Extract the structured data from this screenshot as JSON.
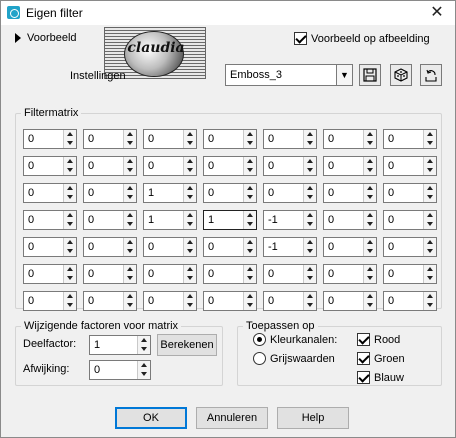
{
  "window": {
    "title": "Eigen filter"
  },
  "preview": {
    "label": "Voorbeeld",
    "on_image_label": "Voorbeeld op afbeelding",
    "on_image_checked": true
  },
  "logo": {
    "text": "claudia"
  },
  "settings": {
    "label": "Instellingen",
    "preset": "Emboss_3"
  },
  "filtermatrix": {
    "label": "Filtermatrix",
    "rows": [
      [
        "0",
        "0",
        "0",
        "0",
        "0",
        "0",
        "0"
      ],
      [
        "0",
        "0",
        "0",
        "0",
        "0",
        "0",
        "0"
      ],
      [
        "0",
        "0",
        "1",
        "0",
        "0",
        "0",
        "0"
      ],
      [
        "0",
        "0",
        "1",
        "1",
        "-1",
        "0",
        "0"
      ],
      [
        "0",
        "0",
        "0",
        "0",
        "-1",
        "0",
        "0"
      ],
      [
        "0",
        "0",
        "0",
        "0",
        "0",
        "0",
        "0"
      ],
      [
        "0",
        "0",
        "0",
        "0",
        "0",
        "0",
        "0"
      ]
    ]
  },
  "factors": {
    "label": "Wijzigende factoren voor matrix",
    "divisor_label": "Deelfactor:",
    "divisor_value": "1",
    "calculate_label": "Berekenen",
    "offset_label": "Afwijking:",
    "offset_value": "0"
  },
  "apply": {
    "label": "Toepassen op",
    "color_channels_label": "Kleurkanalen:",
    "grayscale_label": "Grijswaarden",
    "red_label": "Rood",
    "green_label": "Groen",
    "blue_label": "Blauw"
  },
  "buttons": {
    "ok": "OK",
    "cancel": "Annuleren",
    "help": "Help"
  }
}
